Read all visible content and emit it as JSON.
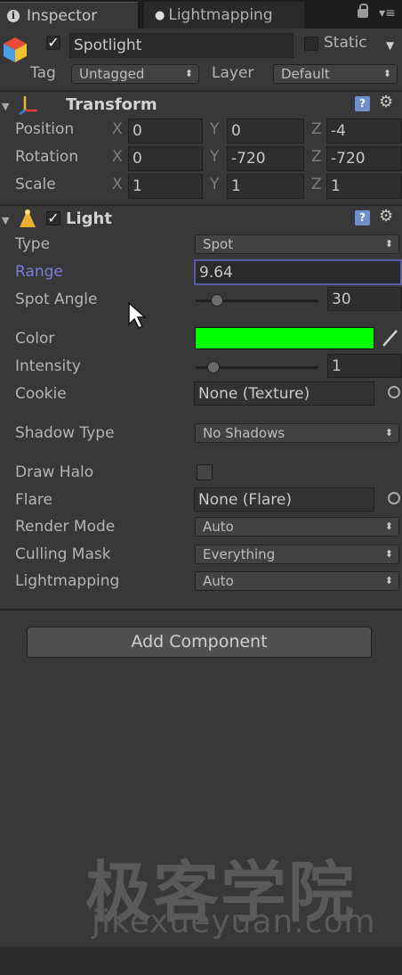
{
  "tabs": [
    {
      "label": "Inspector",
      "icon": "info-icon",
      "active": true
    },
    {
      "label": "Lightmapping",
      "icon": "bulb-icon",
      "active": false
    }
  ],
  "object": {
    "name": "Spotlight",
    "active": true,
    "static_label": "Static",
    "tag_label": "Tag",
    "tag_value": "Untagged",
    "layer_label": "Layer",
    "layer_value": "Default"
  },
  "transform": {
    "title": "Transform",
    "rows": [
      {
        "label": "Position",
        "x": "0",
        "y": "0",
        "z": "-4"
      },
      {
        "label": "Rotation",
        "x": "0",
        "y": "-720",
        "z": "-720"
      },
      {
        "label": "Scale",
        "x": "1",
        "y": "1",
        "z": "1"
      }
    ],
    "axes": [
      "X",
      "Y",
      "Z"
    ]
  },
  "light": {
    "title": "Light",
    "enabled": true,
    "type_label": "Type",
    "type_value": "Spot",
    "range_label": "Range",
    "range_value": "9.64",
    "spot_angle_label": "Spot Angle",
    "spot_angle_value": "30",
    "spot_angle_fraction": 0.17,
    "color_label": "Color",
    "color_value": "#00ff00",
    "intensity_label": "Intensity",
    "intensity_value": "1",
    "intensity_fraction": 0.13,
    "cookie_label": "Cookie",
    "cookie_value": "None (Texture)",
    "shadow_type_label": "Shadow Type",
    "shadow_type_value": "No Shadows",
    "draw_halo_label": "Draw Halo",
    "draw_halo_checked": false,
    "flare_label": "Flare",
    "flare_value": "None (Flare)",
    "render_mode_label": "Render Mode",
    "render_mode_value": "Auto",
    "culling_mask_label": "Culling Mask",
    "culling_mask_value": "Everything",
    "lightmapping_label": "Lightmapping",
    "lightmapping_value": "Auto"
  },
  "add_component_label": "Add Component",
  "watermark": {
    "cn": "极客学院",
    "en": "jikexueyuan.com"
  },
  "colors": {
    "accent_range_label": "#7d7dd8",
    "color_swatch": "#00ff00"
  }
}
